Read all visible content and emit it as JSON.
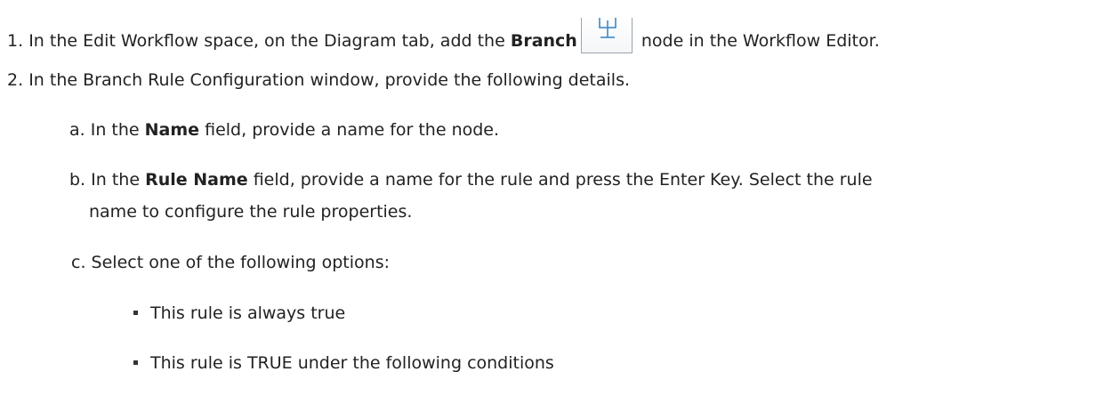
{
  "step1": {
    "number": "1.",
    "text_before": "In the Edit Workflow space, on the Diagram tab, add the",
    "bold": "Branch",
    "icon": "branch-node-icon",
    "text_after": "node in the Workflow Editor."
  },
  "step2": {
    "number": "2.",
    "text": "In the Branch Rule Configuration window, provide the following details."
  },
  "substep_a": {
    "letter": "a.",
    "text_before": "In the",
    "bold": "Name",
    "text_after": "field, provide a name for the node."
  },
  "substep_b": {
    "letter": "b.",
    "text_before": "In the",
    "bold": "Rule Name",
    "text_after": "field, provide a name for the rule and press the Enter Key. Select the rule",
    "text_line2": "name to configure the rule properties."
  },
  "substep_c": {
    "letter": "c.",
    "text": "Select one of the following options:"
  },
  "options": [
    "This rule is always true",
    "This rule is TRUE under the following conditions"
  ]
}
